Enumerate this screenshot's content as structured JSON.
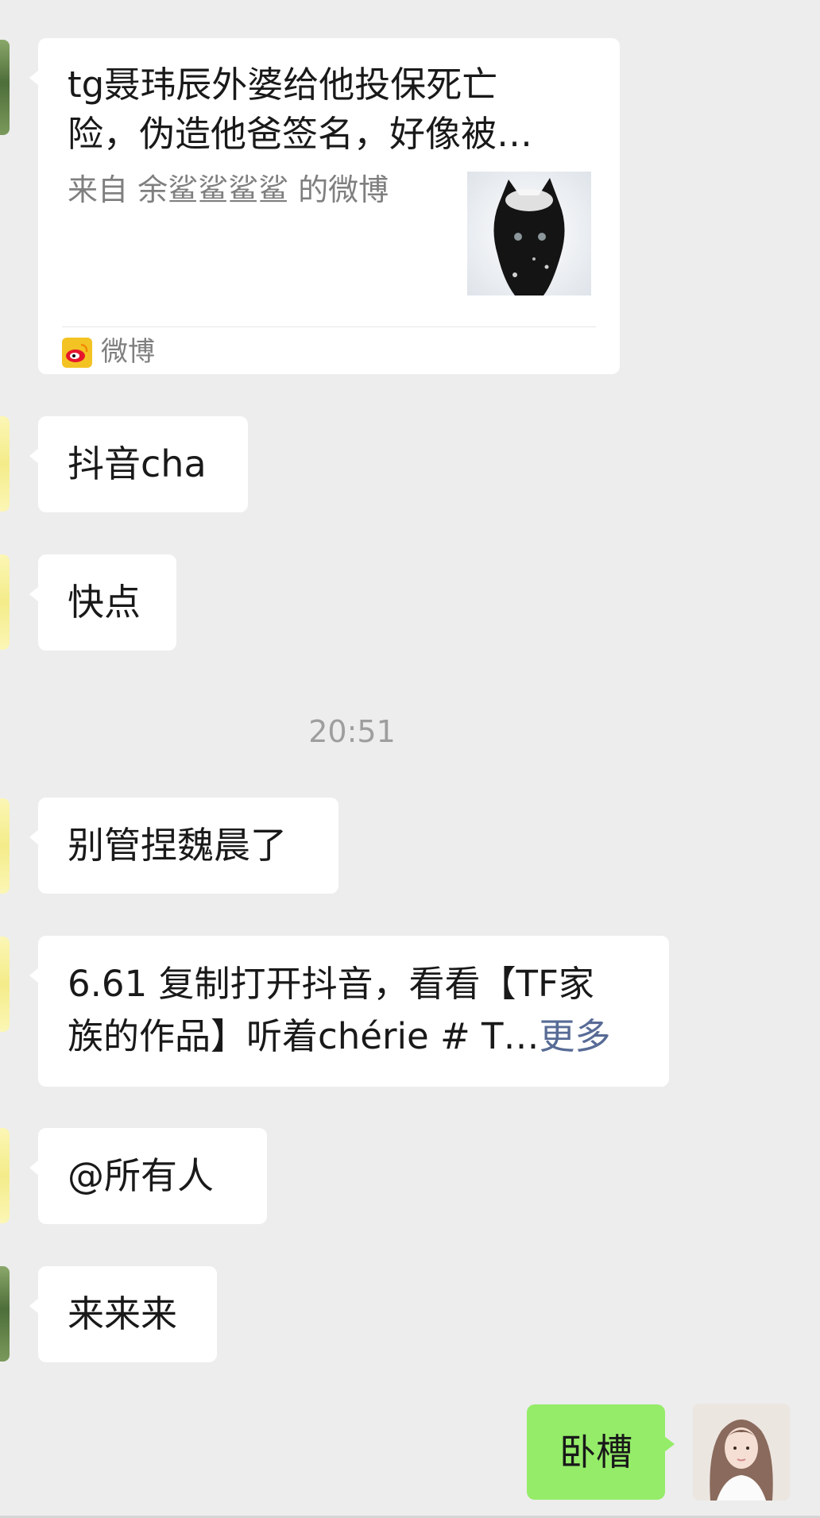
{
  "messages": {
    "link_card": {
      "title_line1": "tg聂玮辰外婆给他投保死亡",
      "title_line2": "险，伪造他爸签名，好像被…",
      "source": "来自 余鲨鲨鲨鲨 的微博",
      "app_name": "微博"
    },
    "msg1": "抖音cha",
    "msg2": "快点",
    "timestamp": "20:51",
    "msg3": "别管捏魏晨了",
    "msg4_line1": "6.61 复制打开抖音，看看【TF家",
    "msg4_line2": "族的作品】听着chérie # T…",
    "msg4_more": "更多",
    "msg5": "@所有人",
    "msg6": "来来来",
    "outgoing": "卧槽"
  },
  "colors": {
    "background": "#ededed",
    "incoming_bubble": "#ffffff",
    "outgoing_bubble": "#95ec69",
    "link": "#576b95",
    "timestamp": "#9e9e9e"
  },
  "icons": {
    "card_thumbnail": "black-cat-in-snow-image",
    "card_app": "weibo-icon",
    "sender_avatars": "avatar",
    "self_avatar": "avatar"
  }
}
